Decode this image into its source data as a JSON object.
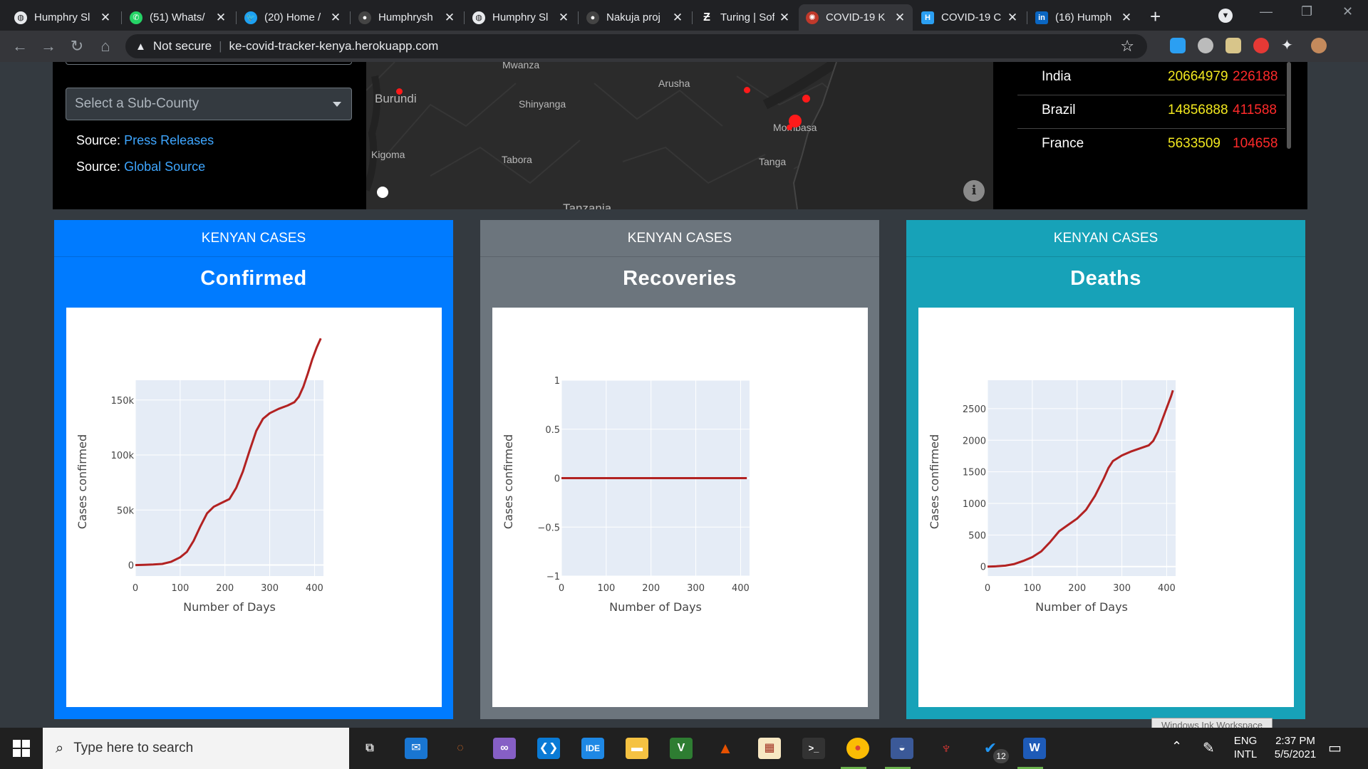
{
  "browser": {
    "tabs": [
      {
        "title": "Humphry Sl",
        "icon": "globe-icon"
      },
      {
        "title": "(51) Whats/",
        "icon": "whatsapp-icon"
      },
      {
        "title": "(20) Home /",
        "icon": "twitter-icon"
      },
      {
        "title": "Humphrysh",
        "icon": "github-icon"
      },
      {
        "title": "Humphry Sl",
        "icon": "globe-icon"
      },
      {
        "title": "Nakuja proj",
        "icon": "github-icon"
      },
      {
        "title": "Turing | Sof",
        "icon": "turing-icon"
      },
      {
        "title": "COVID-19 K",
        "icon": "virus-icon",
        "active": true
      },
      {
        "title": "COVID-19 C",
        "icon": "heroku-icon"
      },
      {
        "title": "(16) Humph",
        "icon": "linkedin-icon"
      }
    ],
    "security_label": "Not secure",
    "url": "ke-covid-tracker-kenya.herokuapp.com"
  },
  "sidebar": {
    "subcounty_placeholder": "Select a Sub-County",
    "source_label_1": "Source:",
    "source_link_1": "Press Releases",
    "source_label_2": "Source:",
    "source_link_2": "Global Source"
  },
  "map": {
    "labels": [
      "Mwanza",
      "Arusha",
      "Burundi",
      "Shinyanga",
      "Mombasa",
      "Kigoma",
      "Tabora",
      "Tanga",
      "Tanzania"
    ]
  },
  "global_table": [
    {
      "country": "India",
      "confirmed": "20664979",
      "deaths": "226188"
    },
    {
      "country": "Brazil",
      "confirmed": "14856888",
      "deaths": "411588"
    },
    {
      "country": "France",
      "confirmed": "5633509",
      "deaths": "104658"
    }
  ],
  "colors": {
    "confirmed_card": "#007bff",
    "recoveries_card": "#6c757d",
    "deaths_card": "#17a2b8",
    "line": "#b22222",
    "plot_bg": "#e5ecf6"
  },
  "cards": [
    {
      "header": "KENYAN CASES",
      "title": "Confirmed"
    },
    {
      "header": "KENYAN CASES",
      "title": "Recoveries"
    },
    {
      "header": "KENYAN CASES",
      "title": "Deaths"
    }
  ],
  "chart_data": [
    {
      "type": "line",
      "title": "",
      "xlabel": "Number of Days",
      "ylabel": "Cases confirmed",
      "xlim": [
        0,
        420
      ],
      "ylim": [
        -10000,
        168000
      ],
      "xticks": [
        0,
        100,
        200,
        300,
        400
      ],
      "xtick_labels": [
        "0",
        "100",
        "200",
        "300",
        "400"
      ],
      "yticks": [
        0,
        50000,
        100000,
        150000
      ],
      "ytick_labels": [
        "0",
        "50k",
        "100k",
        "150k"
      ],
      "x": [
        0,
        20,
        40,
        60,
        80,
        100,
        115,
        130,
        145,
        160,
        175,
        190,
        210,
        225,
        240,
        255,
        270,
        285,
        300,
        320,
        340,
        355,
        365,
        375,
        385,
        395,
        405,
        414
      ],
      "y": [
        0,
        200,
        500,
        1000,
        3000,
        7000,
        12000,
        22000,
        35000,
        47000,
        53000,
        56000,
        60000,
        70000,
        85000,
        104000,
        122000,
        133000,
        138000,
        142000,
        145000,
        148000,
        153000,
        162000,
        174000,
        187000,
        198000,
        206000
      ]
    },
    {
      "type": "line",
      "title": "",
      "xlabel": "Number of Days",
      "ylabel": "Cases confirmed",
      "xlim": [
        0,
        420
      ],
      "ylim": [
        -1,
        1
      ],
      "xticks": [
        0,
        100,
        200,
        300,
        400
      ],
      "xtick_labels": [
        "0",
        "100",
        "200",
        "300",
        "400"
      ],
      "yticks": [
        -1,
        -0.5,
        0,
        0.5,
        1
      ],
      "ytick_labels": [
        "−1",
        "−0.5",
        "0",
        "0.5",
        "1"
      ],
      "x": [
        0,
        100,
        200,
        300,
        414
      ],
      "y": [
        0,
        0,
        0,
        0,
        0
      ]
    },
    {
      "type": "line",
      "title": "",
      "xlabel": "Number of Days",
      "ylabel": "Cases confirmed",
      "xlim": [
        0,
        420
      ],
      "ylim": [
        -150,
        2950
      ],
      "xticks": [
        0,
        100,
        200,
        300,
        400
      ],
      "xtick_labels": [
        "0",
        "100",
        "200",
        "300",
        "400"
      ],
      "yticks": [
        0,
        500,
        1000,
        1500,
        2000,
        2500
      ],
      "ytick_labels": [
        "0",
        "500",
        "1000",
        "1500",
        "2000",
        "2500"
      ],
      "x": [
        0,
        20,
        40,
        60,
        80,
        100,
        120,
        140,
        160,
        180,
        200,
        220,
        240,
        260,
        270,
        280,
        300,
        320,
        340,
        360,
        370,
        380,
        390,
        400,
        410,
        414
      ],
      "y": [
        0,
        5,
        15,
        40,
        90,
        150,
        240,
        390,
        560,
        660,
        760,
        900,
        1120,
        1400,
        1560,
        1670,
        1760,
        1820,
        1870,
        1920,
        1990,
        2130,
        2320,
        2510,
        2700,
        2790
      ]
    }
  ],
  "taskbar": {
    "search_placeholder": "Type here to search",
    "lang_1": "ENG",
    "lang_2": "INTL",
    "time": "2:37 PM",
    "date": "5/5/2021",
    "ink_workspace": "Windows Ink Workspace",
    "todo_badge": "12"
  }
}
